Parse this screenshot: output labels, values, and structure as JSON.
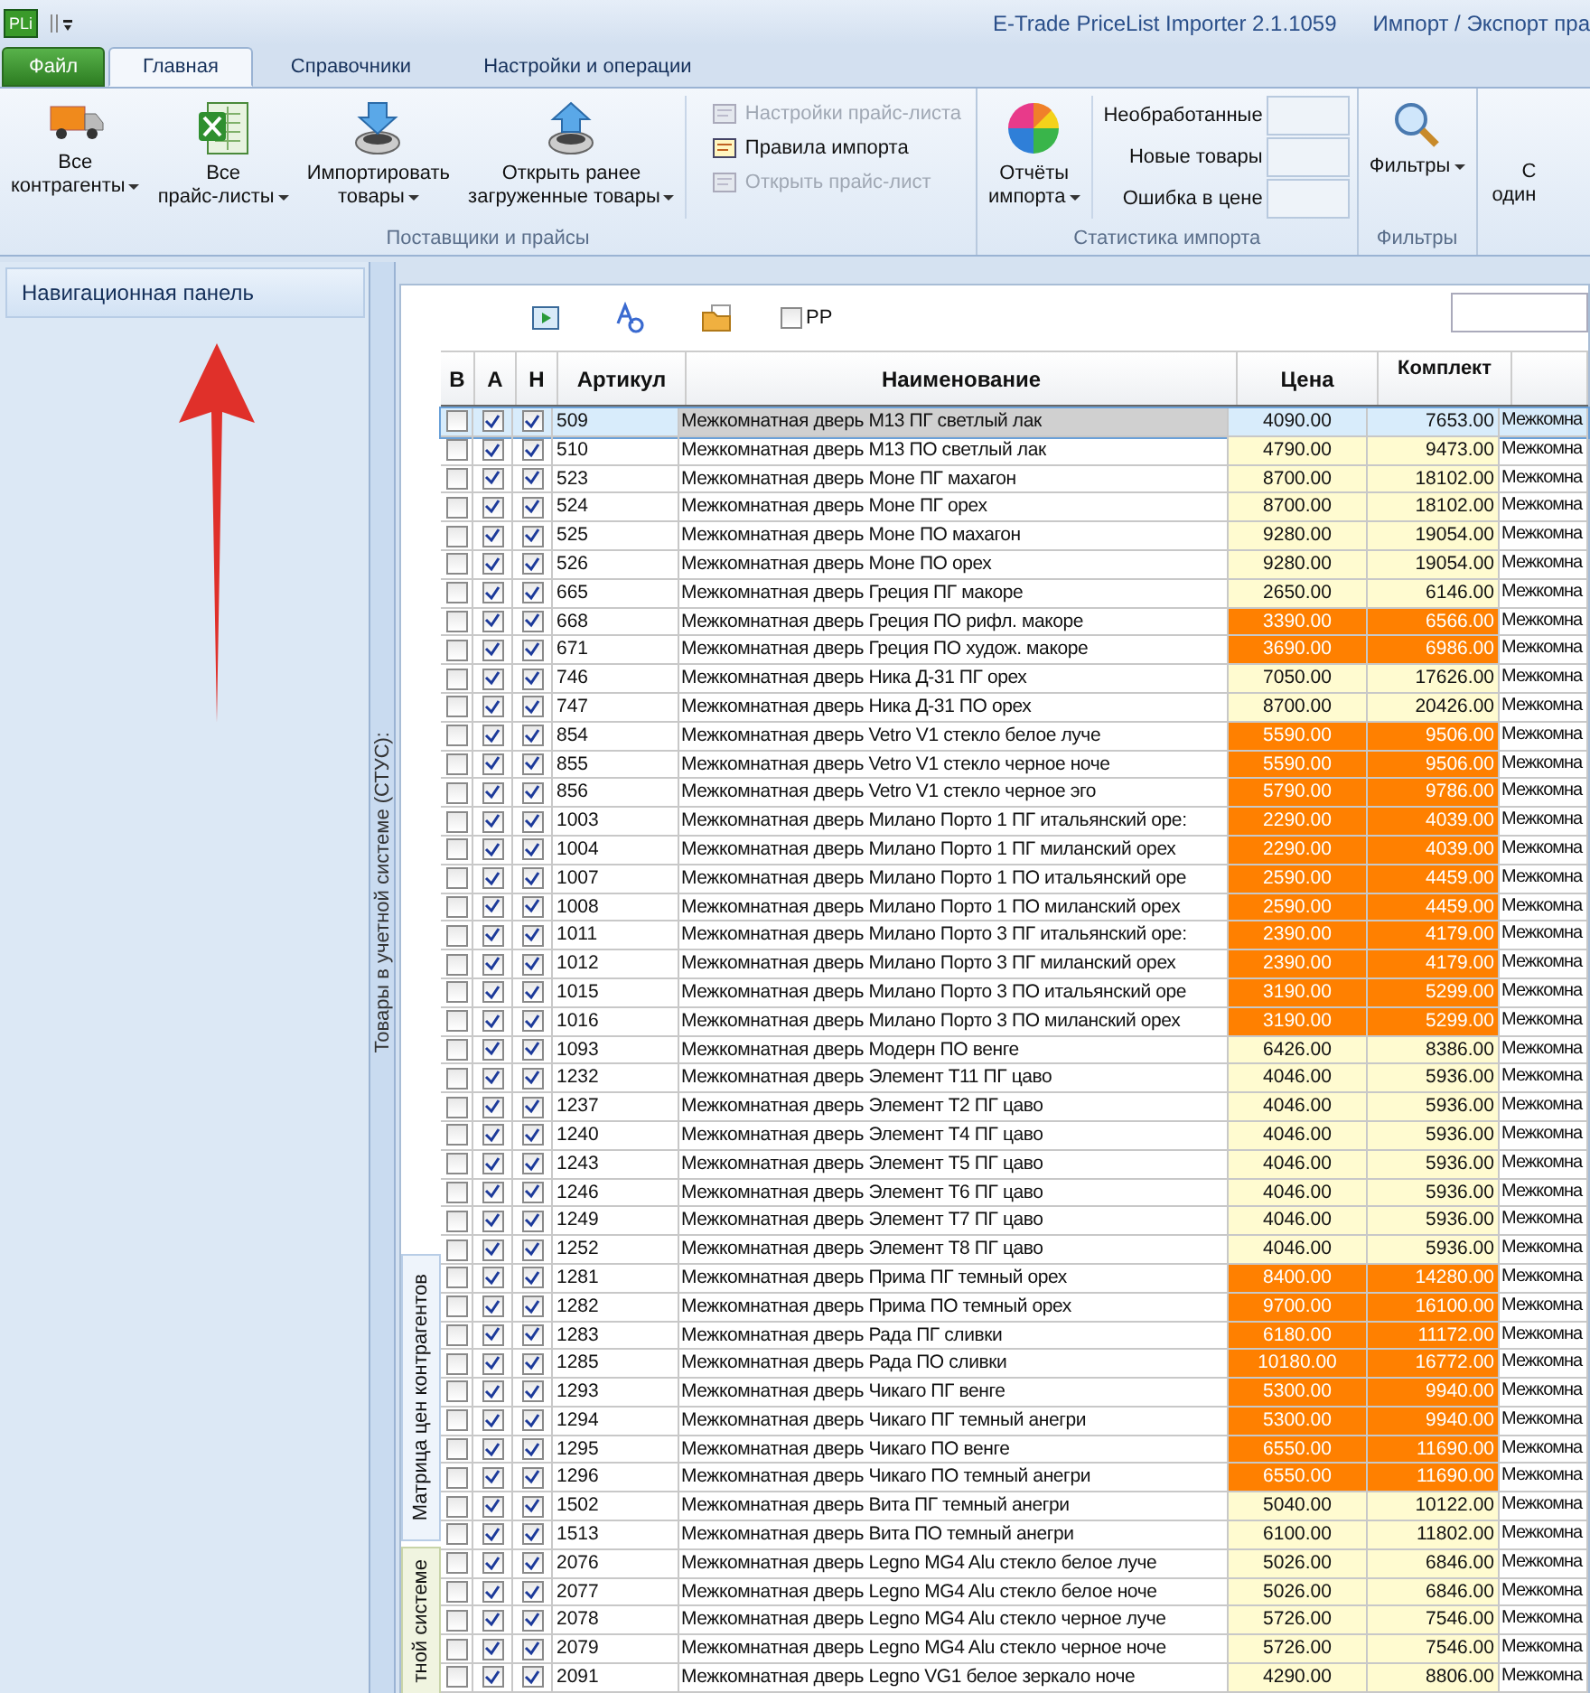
{
  "window": {
    "app_icon": "PLi",
    "title": "E-Trade PriceList Importer 2.1.1059",
    "subtitle": "Импорт / Экспорт пра"
  },
  "file_menu": {
    "label": "Файл"
  },
  "ribbon_tabs": [
    {
      "label": "Главная",
      "selected": true
    },
    {
      "label": "Справочники",
      "selected": false
    },
    {
      "label": "Настройки и операции",
      "selected": false
    }
  ],
  "ribbon_groups": [
    {
      "label": "Поставщики и прайсы",
      "large_buttons": [
        {
          "label": "Все\nконтрагенты"
        },
        {
          "label": "Все\nпрайс-листы"
        },
        {
          "label": "Импортировать\nтовары"
        },
        {
          "label": "Открыть ранее\nзагруженные товары"
        }
      ],
      "small_buttons": [
        {
          "label": "Настройки прайс-листа",
          "disabled": true
        },
        {
          "label": "Правила импорта",
          "disabled": false
        },
        {
          "label": "Открыть прайс-лист",
          "disabled": true
        }
      ]
    },
    {
      "label": "Статистика импорта",
      "large_buttons": [
        {
          "label": "Отчёты\nимпорта"
        }
      ],
      "stats": [
        "Необработанные",
        "Новые товары",
        "Ошибка в цене"
      ]
    },
    {
      "label": "Фильтры",
      "large_buttons": [
        {
          "label": "Фильтры"
        }
      ]
    }
  ],
  "ribbon_cut_button": {
    "line_1": "С",
    "line_2": "один"
  },
  "nav_panel": {
    "title": "Навигационная панель"
  },
  "side_strip": {
    "label": "Товары в учетной системе (СТУС):"
  },
  "side_tabs": [
    {
      "label": "Матрица цен контрагентов",
      "selected": true
    },
    {
      "label": "тной системе",
      "selected": false
    }
  ],
  "toolbar": {
    "pp_checkbox": {
      "label": "PP",
      "checked": false
    }
  },
  "table": {
    "columns": [
      "В",
      "А",
      "Н",
      "Артикул",
      "Наименование",
      "Цена",
      "Комплект"
    ],
    "rows": [
      {
        "b": false,
        "a": true,
        "n": true,
        "article": "509",
        "name": "Межкомнатная дверь М13 ПГ светлый лак",
        "price": "4090.00",
        "kit": "7653.00",
        "column_8": "Межкомна",
        "highlight": false,
        "selected": true
      },
      {
        "b": false,
        "a": true,
        "n": true,
        "article": "510",
        "name": "Межкомнатная дверь М13 ПО светлый лак",
        "price": "4790.00",
        "kit": "9473.00",
        "column_8": "Межкомна",
        "highlight": false,
        "selected": false
      },
      {
        "b": false,
        "a": true,
        "n": true,
        "article": "523",
        "name": "Межкомнатная дверь Моне ПГ махагон",
        "price": "8700.00",
        "kit": "18102.00",
        "column_8": "Межкомна",
        "highlight": false,
        "selected": false
      },
      {
        "b": false,
        "a": true,
        "n": true,
        "article": "524",
        "name": "Межкомнатная дверь Моне ПГ орех",
        "price": "8700.00",
        "kit": "18102.00",
        "column_8": "Межкомна",
        "highlight": false,
        "selected": false
      },
      {
        "b": false,
        "a": true,
        "n": true,
        "article": "525",
        "name": "Межкомнатная дверь Моне ПО махагон",
        "price": "9280.00",
        "kit": "19054.00",
        "column_8": "Межкомна",
        "highlight": false,
        "selected": false
      },
      {
        "b": false,
        "a": true,
        "n": true,
        "article": "526",
        "name": "Межкомнатная дверь Моне ПО орех",
        "price": "9280.00",
        "kit": "19054.00",
        "column_8": "Межкомна",
        "highlight": false,
        "selected": false
      },
      {
        "b": false,
        "a": true,
        "n": true,
        "article": "665",
        "name": "Межкомнатная дверь Греция ПГ макоре",
        "price": "2650.00",
        "kit": "6146.00",
        "column_8": "Межкомна",
        "highlight": false,
        "selected": false
      },
      {
        "b": false,
        "a": true,
        "n": true,
        "article": "668",
        "name": "Межкомнатная дверь Греция ПО рифл. макоре",
        "price": "3390.00",
        "kit": "6566.00",
        "column_8": "Межкомна",
        "highlight": true,
        "selected": false
      },
      {
        "b": false,
        "a": true,
        "n": true,
        "article": "671",
        "name": "Межкомнатная дверь Греция ПО худож. макоре",
        "price": "3690.00",
        "kit": "6986.00",
        "column_8": "Межкомна",
        "highlight": true,
        "selected": false
      },
      {
        "b": false,
        "a": true,
        "n": true,
        "article": "746",
        "name": "Межкомнатная дверь Ника Д-31 ПГ орех",
        "price": "7050.00",
        "kit": "17626.00",
        "column_8": "Межкомна",
        "highlight": false,
        "selected": false
      },
      {
        "b": false,
        "a": true,
        "n": true,
        "article": "747",
        "name": "Межкомнатная дверь Ника Д-31 ПО орех",
        "price": "8700.00",
        "kit": "20426.00",
        "column_8": "Межкомна",
        "highlight": false,
        "selected": false
      },
      {
        "b": false,
        "a": true,
        "n": true,
        "article": "854",
        "name": "Межкомнатная дверь Vetro V1 стекло белое луче",
        "price": "5590.00",
        "kit": "9506.00",
        "column_8": "Межкомна",
        "highlight": true,
        "selected": false
      },
      {
        "b": false,
        "a": true,
        "n": true,
        "article": "855",
        "name": "Межкомнатная дверь Vetro V1 стекло черное ноче",
        "price": "5590.00",
        "kit": "9506.00",
        "column_8": "Межкомна",
        "highlight": true,
        "selected": false
      },
      {
        "b": false,
        "a": true,
        "n": true,
        "article": "856",
        "name": "Межкомнатная дверь Vetro V1 стекло черное эго",
        "price": "5790.00",
        "kit": "9786.00",
        "column_8": "Межкомна",
        "highlight": true,
        "selected": false
      },
      {
        "b": false,
        "a": true,
        "n": true,
        "article": "1003",
        "name": "Межкомнатная дверь Милано Порто 1 ПГ итальянский оре:",
        "price": "2290.00",
        "kit": "4039.00",
        "column_8": "Межкомна",
        "highlight": true,
        "selected": false
      },
      {
        "b": false,
        "a": true,
        "n": true,
        "article": "1004",
        "name": "Межкомнатная дверь Милано Порто 1 ПГ миланский орех",
        "price": "2290.00",
        "kit": "4039.00",
        "column_8": "Межкомна",
        "highlight": true,
        "selected": false
      },
      {
        "b": false,
        "a": true,
        "n": true,
        "article": "1007",
        "name": "Межкомнатная дверь Милано Порто 1 ПО итальянский оре",
        "price": "2590.00",
        "kit": "4459.00",
        "column_8": "Межкомна",
        "highlight": true,
        "selected": false
      },
      {
        "b": false,
        "a": true,
        "n": true,
        "article": "1008",
        "name": "Межкомнатная дверь Милано Порто 1 ПО миланский орех",
        "price": "2590.00",
        "kit": "4459.00",
        "column_8": "Межкомна",
        "highlight": true,
        "selected": false
      },
      {
        "b": false,
        "a": true,
        "n": true,
        "article": "1011",
        "name": "Межкомнатная дверь Милано Порто 3 ПГ итальянский оре:",
        "price": "2390.00",
        "kit": "4179.00",
        "column_8": "Межкомна",
        "highlight": true,
        "selected": false
      },
      {
        "b": false,
        "a": true,
        "n": true,
        "article": "1012",
        "name": "Межкомнатная дверь Милано Порто 3 ПГ миланский орех",
        "price": "2390.00",
        "kit": "4179.00",
        "column_8": "Межкомна",
        "highlight": true,
        "selected": false
      },
      {
        "b": false,
        "a": true,
        "n": true,
        "article": "1015",
        "name": "Межкомнатная дверь Милано Порто 3 ПО итальянский оре",
        "price": "3190.00",
        "kit": "5299.00",
        "column_8": "Межкомна",
        "highlight": true,
        "selected": false
      },
      {
        "b": false,
        "a": true,
        "n": true,
        "article": "1016",
        "name": "Межкомнатная дверь Милано Порто 3 ПО миланский орех",
        "price": "3190.00",
        "kit": "5299.00",
        "column_8": "Межкомна",
        "highlight": true,
        "selected": false
      },
      {
        "b": false,
        "a": true,
        "n": true,
        "article": "1093",
        "name": "Межкомнатная дверь Модерн ПО венге",
        "price": "6426.00",
        "kit": "8386.00",
        "column_8": "Межкомна",
        "highlight": false,
        "selected": false
      },
      {
        "b": false,
        "a": true,
        "n": true,
        "article": "1232",
        "name": "Межкомнатная дверь Элемент Т11 ПГ цаво",
        "price": "4046.00",
        "kit": "5936.00",
        "column_8": "Межкомна",
        "highlight": false,
        "selected": false
      },
      {
        "b": false,
        "a": true,
        "n": true,
        "article": "1237",
        "name": "Межкомнатная дверь Элемент Т2 ПГ цаво",
        "price": "4046.00",
        "kit": "5936.00",
        "column_8": "Межкомна",
        "highlight": false,
        "selected": false
      },
      {
        "b": false,
        "a": true,
        "n": true,
        "article": "1240",
        "name": "Межкомнатная дверь Элемент Т4 ПГ цаво",
        "price": "4046.00",
        "kit": "5936.00",
        "column_8": "Межкомна",
        "highlight": false,
        "selected": false
      },
      {
        "b": false,
        "a": true,
        "n": true,
        "article": "1243",
        "name": "Межкомнатная дверь Элемент Т5 ПГ цаво",
        "price": "4046.00",
        "kit": "5936.00",
        "column_8": "Межкомна",
        "highlight": false,
        "selected": false
      },
      {
        "b": false,
        "a": true,
        "n": true,
        "article": "1246",
        "name": "Межкомнатная дверь Элемент Т6 ПГ цаво",
        "price": "4046.00",
        "kit": "5936.00",
        "column_8": "Межкомна",
        "highlight": false,
        "selected": false
      },
      {
        "b": false,
        "a": true,
        "n": true,
        "article": "1249",
        "name": "Межкомнатная дверь Элемент Т7 ПГ цаво",
        "price": "4046.00",
        "kit": "5936.00",
        "column_8": "Межкомна",
        "highlight": false,
        "selected": false
      },
      {
        "b": false,
        "a": true,
        "n": true,
        "article": "1252",
        "name": "Межкомнатная дверь Элемент Т8 ПГ цаво",
        "price": "4046.00",
        "kit": "5936.00",
        "column_8": "Межкомна",
        "highlight": false,
        "selected": false
      },
      {
        "b": false,
        "a": true,
        "n": true,
        "article": "1281",
        "name": "Межкомнатная дверь Прима ПГ темный орех",
        "price": "8400.00",
        "kit": "14280.00",
        "column_8": "Межкомна",
        "highlight": true,
        "selected": false
      },
      {
        "b": false,
        "a": true,
        "n": true,
        "article": "1282",
        "name": "Межкомнатная дверь Прима ПО темный орех",
        "price": "9700.00",
        "kit": "16100.00",
        "column_8": "Межкомна",
        "highlight": true,
        "selected": false
      },
      {
        "b": false,
        "a": true,
        "n": true,
        "article": "1283",
        "name": "Межкомнатная дверь Рада ПГ сливки",
        "price": "6180.00",
        "kit": "11172.00",
        "column_8": "Межкомна",
        "highlight": true,
        "selected": false
      },
      {
        "b": false,
        "a": true,
        "n": true,
        "article": "1285",
        "name": "Межкомнатная дверь Рада ПО сливки",
        "price": "10180.00",
        "kit": "16772.00",
        "column_8": "Межкомна",
        "highlight": true,
        "selected": false
      },
      {
        "b": false,
        "a": true,
        "n": true,
        "article": "1293",
        "name": "Межкомнатная дверь Чикаго ПГ венге",
        "price": "5300.00",
        "kit": "9940.00",
        "column_8": "Межкомна",
        "highlight": true,
        "selected": false
      },
      {
        "b": false,
        "a": true,
        "n": true,
        "article": "1294",
        "name": "Межкомнатная дверь Чикаго ПГ темный анегри",
        "price": "5300.00",
        "kit": "9940.00",
        "column_8": "Межкомна",
        "highlight": true,
        "selected": false
      },
      {
        "b": false,
        "a": true,
        "n": true,
        "article": "1295",
        "name": "Межкомнатная дверь Чикаго ПО венге",
        "price": "6550.00",
        "kit": "11690.00",
        "column_8": "Межкомна",
        "highlight": true,
        "selected": false
      },
      {
        "b": false,
        "a": true,
        "n": true,
        "article": "1296",
        "name": "Межкомнатная дверь Чикаго ПО темный анегри",
        "price": "6550.00",
        "kit": "11690.00",
        "column_8": "Межкомна",
        "highlight": true,
        "selected": false
      },
      {
        "b": false,
        "a": true,
        "n": true,
        "article": "1502",
        "name": "Межкомнатная дверь Вита ПГ темный анегри",
        "price": "5040.00",
        "kit": "10122.00",
        "column_8": "Межкомна",
        "highlight": false,
        "selected": false
      },
      {
        "b": false,
        "a": true,
        "n": true,
        "article": "1513",
        "name": "Межкомнатная дверь Вита ПО темный анегри",
        "price": "6100.00",
        "kit": "11802.00",
        "column_8": "Межкомна",
        "highlight": false,
        "selected": false
      },
      {
        "b": false,
        "a": true,
        "n": true,
        "article": "2076",
        "name": "Межкомнатная дверь Legno MG4 Alu стекло белое луче",
        "price": "5026.00",
        "kit": "6846.00",
        "column_8": "Межкомна",
        "highlight": false,
        "selected": false
      },
      {
        "b": false,
        "a": true,
        "n": true,
        "article": "2077",
        "name": "Межкомнатная дверь Legno MG4 Alu стекло белое ноче",
        "price": "5026.00",
        "kit": "6846.00",
        "column_8": "Межкомна",
        "highlight": false,
        "selected": false
      },
      {
        "b": false,
        "a": true,
        "n": true,
        "article": "2078",
        "name": "Межкомнатная дверь Legno MG4 Alu стекло черное луче",
        "price": "5726.00",
        "kit": "7546.00",
        "column_8": "Межкомна",
        "highlight": false,
        "selected": false
      },
      {
        "b": false,
        "a": true,
        "n": true,
        "article": "2079",
        "name": "Межкомнатная дверь Legno MG4 Alu стекло черное ноче",
        "price": "5726.00",
        "kit": "7546.00",
        "column_8": "Межкомна",
        "highlight": false,
        "selected": false
      },
      {
        "b": false,
        "a": true,
        "n": true,
        "article": "2091",
        "name": "Межкомнатная дверь Legno VG1 белое зеркало ноче",
        "price": "4290.00",
        "kit": "8806.00",
        "column_8": "Межкомна",
        "highlight": false,
        "selected": false
      }
    ]
  }
}
